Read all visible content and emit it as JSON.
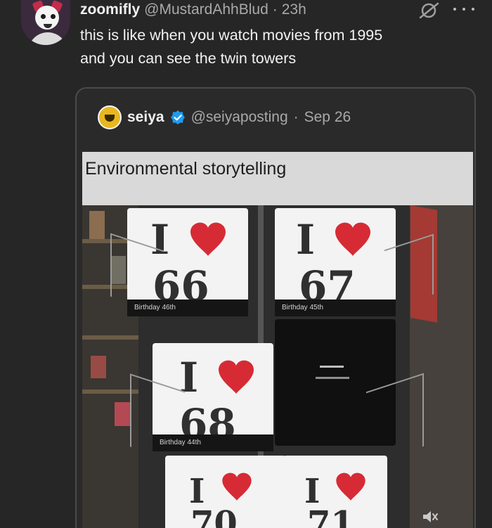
{
  "post": {
    "author_name": "zoomifly",
    "author_handle": "@MustardAhhBlud",
    "separator": "·",
    "time": "23h",
    "text": "this is like when you watch movies from 1995\nand you can see the twin towers"
  },
  "quoted": {
    "name": "seiya",
    "handle": "@seiyaposting",
    "separator": "·",
    "date": "Sep 26",
    "caption": "Environmental storytelling"
  },
  "cards": [
    {
      "i": "I",
      "number": "66",
      "band": "Birthday 46th"
    },
    {
      "i": "I",
      "number": "67",
      "band": "Birthday 45th"
    },
    {
      "i": "I",
      "number": "68",
      "band": "Birthday 44th"
    },
    {
      "i": "I",
      "number": "70",
      "band": ""
    },
    {
      "i": "I",
      "number": "71",
      "band": ""
    }
  ],
  "colors": {
    "background": "#262626",
    "heart": "#d62b35",
    "verified": "#1d9bf0"
  },
  "icons": {
    "grok": "grok-icon",
    "more": "more-icon",
    "verified": "verified-icon",
    "mute": "speaker-mute-icon"
  }
}
